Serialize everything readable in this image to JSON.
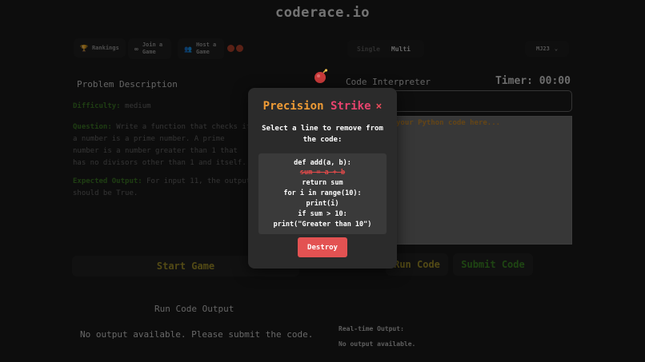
{
  "app": {
    "brand": "coderace.io"
  },
  "nav": {
    "rankings": "Rankings",
    "join_game": "Join a Game",
    "host_game": "Host a Game",
    "mode_single": "Single",
    "mode_multi": "Multi",
    "user": "MJ23"
  },
  "problem": {
    "heading": "Problem Description",
    "difficulty_label": "Difficulty:",
    "difficulty_value": "medium",
    "question_label": "Question:",
    "question_text": "Write a function that checks if a number is a prime number. A prime number is a number greater than 1 that has no divisors other than 1 and itself.",
    "expected_label": "Expected Output:",
    "expected_text": "For input 11, the output should be True."
  },
  "buttons": {
    "start_game": "Start Game",
    "run_code": "Run Code",
    "submit_code": "Submit Code"
  },
  "interpreter": {
    "heading": "Code Interpreter",
    "timer": "Timer: 00:00",
    "placeholder": "your Python code here..."
  },
  "output": {
    "heading": "Run Code Output",
    "message": "No output available. Please submit the code.",
    "realtime_label": "Real-time Output:",
    "realtime_value": "No output available."
  },
  "modal": {
    "title_part1": "Precision",
    "title_part2": "Strike",
    "close_symbol": "×",
    "instruction": "Select a line to remove from the code:",
    "code_lines": [
      "def add(a, b):",
      "sum = a + b",
      "return sum",
      "for i in range(10):",
      "print(i)",
      "if sum > 10:",
      "print(\"Greater than 10\")"
    ],
    "destroy_label": "Destroy"
  },
  "colors": {
    "background": "#1a1a1a",
    "accent_green": "#3d7a25",
    "accent_yellow": "#a4932a",
    "destroy": "#e35252",
    "title_orange": "#ee9b36",
    "title_pink": "#e8436e"
  },
  "icons": [
    "trophy-icon",
    "gamepad-icon",
    "users-icon",
    "chevron-down-icon",
    "bomb-icon",
    "close-icon"
  ]
}
